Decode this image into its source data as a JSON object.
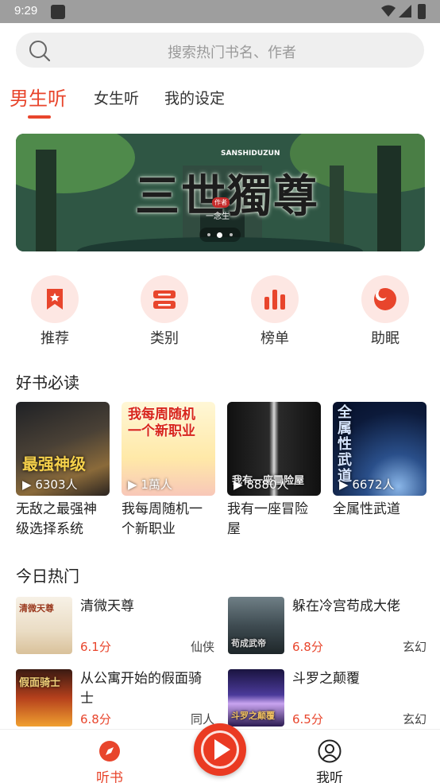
{
  "status_bar": {
    "time": "9:29"
  },
  "search": {
    "placeholder": "搜索热门书名、作者"
  },
  "tabs": [
    {
      "label": "男生听",
      "active": true
    },
    {
      "label": "女生听",
      "active": false
    },
    {
      "label": "我的设定",
      "active": false
    }
  ],
  "banner": {
    "title": "三世獨尊",
    "pinyin": "SANSHIDUZUN",
    "author_tag": "作者",
    "author": "一念生",
    "page_count": 3,
    "active_page": 2
  },
  "categories": [
    {
      "label": "推荐",
      "icon": "bookmark-star-icon"
    },
    {
      "label": "类别",
      "icon": "category-icon"
    },
    {
      "label": "榜单",
      "icon": "ranking-bars-icon"
    },
    {
      "label": "助眠",
      "icon": "sleep-moon-icon"
    }
  ],
  "must_read": {
    "title": "好书必读",
    "books": [
      {
        "name": "无敌之最强神级选择系统",
        "listeners": "6303人",
        "cover_text": "最强神级"
      },
      {
        "name": "我每周随机一个新职业",
        "listeners": "1萬人",
        "cover_text": "我每周随机一个新职业"
      },
      {
        "name": "我有一座冒险屋",
        "listeners": "8880人",
        "cover_text": "我有一座冒险屋"
      },
      {
        "name": "全属性武道",
        "listeners": "6672人",
        "cover_text": "全属性武道"
      }
    ]
  },
  "hot_today": {
    "title": "今日热门",
    "items": [
      {
        "title": "清微天尊",
        "score": "6.1分",
        "genre": "仙侠",
        "cover_text": "清微天尊"
      },
      {
        "title": "躲在冷宫苟成大佬",
        "score": "6.8分",
        "genre": "玄幻",
        "cover_text": "苟成武帝"
      },
      {
        "title": "从公寓开始的假面骑士",
        "score": "6.8分",
        "genre": "同人",
        "cover_text": "假面骑士"
      },
      {
        "title": "斗罗之颠覆",
        "score": "6.5分",
        "genre": "玄幻",
        "cover_text": "斗罗之颠覆"
      }
    ]
  },
  "bottom_nav": {
    "left": {
      "label": "听书",
      "icon": "compass-icon"
    },
    "center": {
      "icon": "play-icon"
    },
    "right": {
      "label": "我听",
      "icon": "user-icon"
    }
  },
  "colors": {
    "accent": "#e8452c",
    "accent_light": "#fde7e3"
  }
}
